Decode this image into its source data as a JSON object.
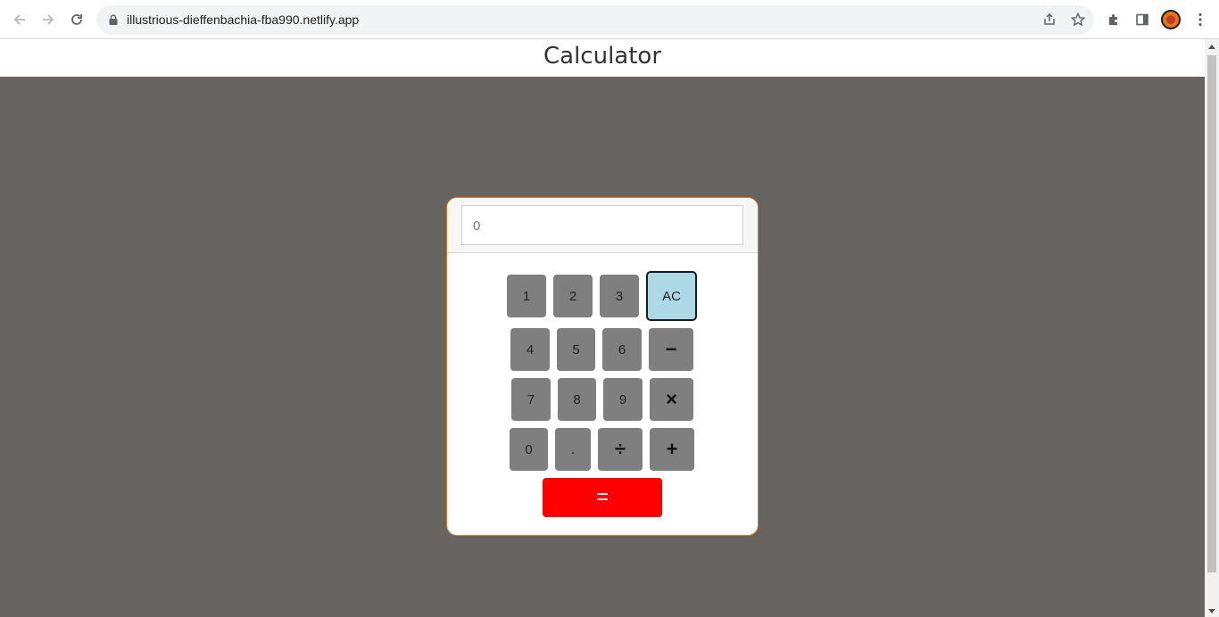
{
  "browser": {
    "url": "illustrious-dieffenbachia-fba990.netlify.app"
  },
  "page": {
    "title": "Calculator"
  },
  "calculator": {
    "display_placeholder": "0",
    "keys": {
      "one": "1",
      "two": "2",
      "three": "3",
      "ac": "AC",
      "four": "4",
      "five": "5",
      "six": "6",
      "minus": "−",
      "seven": "7",
      "eight": "8",
      "nine": "9",
      "multiply": "×",
      "zero": "0",
      "decimal": ".",
      "divide": "÷",
      "plus": "+",
      "equals": "="
    }
  }
}
